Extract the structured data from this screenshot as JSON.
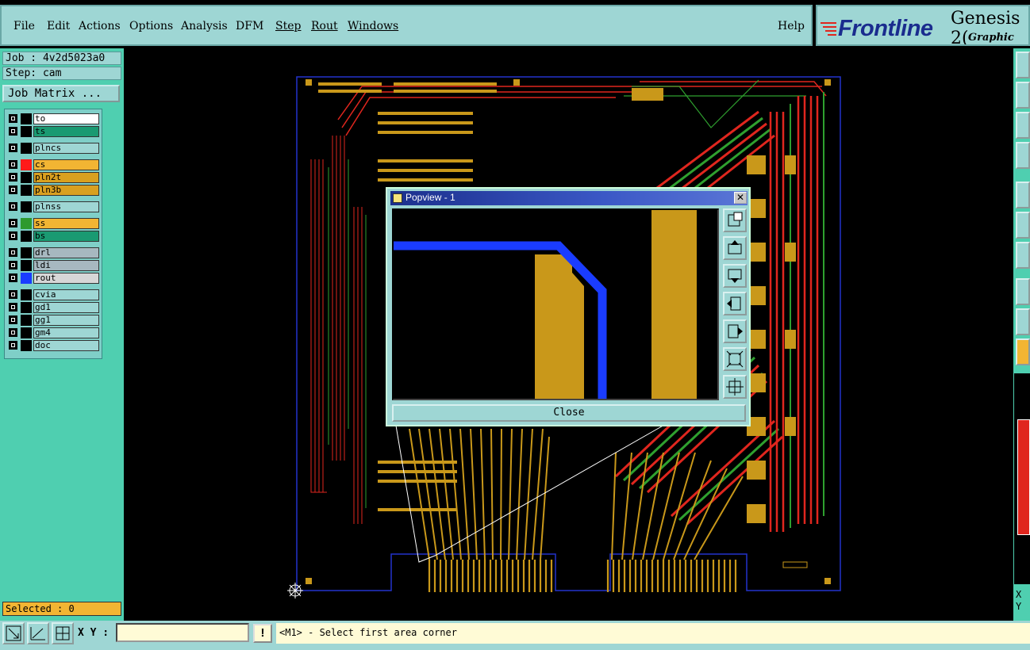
{
  "menu": {
    "file": "File",
    "edit": "Edit",
    "actions": "Actions",
    "options": "Options",
    "analysis": "Analysis",
    "dfm": "DFM",
    "step": "Step",
    "rout": "Rout",
    "windows": "Windows",
    "help": "Help"
  },
  "logo": {
    "brand": "Frontline",
    "product": "Genesis 2(",
    "subtitle": "Graphic Edito"
  },
  "job": {
    "job_label": "Job : 4v2d5023a0",
    "step_label": "Step: cam",
    "matrix_button": "Job Matrix ..."
  },
  "layers": [
    {
      "name": "to",
      "color": "#ffffff",
      "swatch": "#000000"
    },
    {
      "name": "ts",
      "color": "#1a9a72",
      "swatch": "#000000"
    },
    {
      "name": "plncs",
      "color": "#9ed6d4",
      "swatch": "#000000"
    },
    {
      "name": "cs",
      "color": "#f2b533",
      "swatch": "#ff1a1a"
    },
    {
      "name": "pln2t",
      "color": "#d9a020",
      "swatch": "#000000"
    },
    {
      "name": "pln3b",
      "color": "#d9a020",
      "swatch": "#000000"
    },
    {
      "name": "plnss",
      "color": "#9ed6d4",
      "swatch": "#000000"
    },
    {
      "name": "ss",
      "color": "#f2b533",
      "swatch": "#2e9a2e"
    },
    {
      "name": "bs",
      "color": "#1a9a72",
      "swatch": "#000000"
    },
    {
      "name": "drl",
      "color": "#a7b8c0",
      "swatch": "#000000"
    },
    {
      "name": "ldi",
      "color": "#a7b8c0",
      "swatch": "#000000"
    },
    {
      "name": "rout",
      "color": "#d7d7d7",
      "swatch": "#1a3cff"
    },
    {
      "name": "cvia",
      "color": "#9ed6d4",
      "swatch": "#000000"
    },
    {
      "name": "gd1",
      "color": "#9ed6d4",
      "swatch": "#000000"
    },
    {
      "name": "gg1",
      "color": "#9ed6d4",
      "swatch": "#000000"
    },
    {
      "name": "gm4",
      "color": "#9ed6d4",
      "swatch": "#000000"
    },
    {
      "name": "doc",
      "color": "#9ed6d4",
      "swatch": "#000000"
    }
  ],
  "selected": "Selected : 0",
  "popview": {
    "title": "Popview - 1",
    "close_label": "Close",
    "close_x": "✕"
  },
  "bottom": {
    "xy_label": "X Y :",
    "xy_value": "",
    "bang": "!",
    "status": "<M1> - Select first area corner"
  },
  "right_readout": {
    "x": "X",
    "y": "Y"
  },
  "colors": {
    "panel": "#4fcfb0",
    "menu": "#9ed6d4",
    "copper": "#c9981a",
    "trace_red": "#e0261e",
    "trace_green": "#2fa02f",
    "rout_blue": "#1a3cff"
  }
}
